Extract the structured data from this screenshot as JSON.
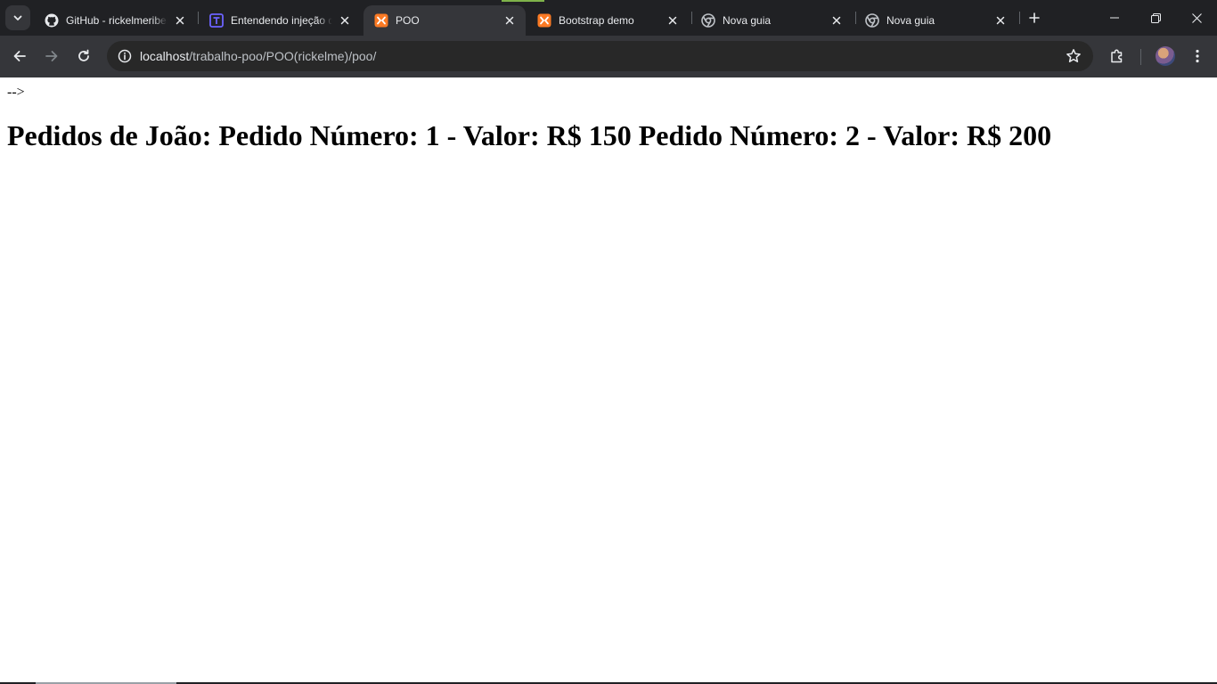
{
  "browser": {
    "tabs": [
      {
        "title": "GitHub - rickelmeribeiro",
        "favicon": "github-icon",
        "active": false
      },
      {
        "title": "Entendendo injeção de dependência",
        "favicon": "devmedia-icon",
        "active": false
      },
      {
        "title": "POO",
        "favicon": "xampp-icon",
        "active": true
      },
      {
        "title": "Bootstrap demo",
        "favicon": "xampp-icon",
        "active": false
      },
      {
        "title": "Nova guia",
        "favicon": "chrome-icon",
        "active": false
      },
      {
        "title": "Nova guia",
        "favicon": "chrome-icon",
        "active": false
      }
    ],
    "address": {
      "host": "localhost",
      "path": "/trabalho-poo/POO(rickelme)/poo/"
    }
  },
  "page": {
    "comment_residue": "-->",
    "heading": "Pedidos de João: Pedido Número: 1 - Valor: R$ 150 Pedido Número: 2 - Valor: R$ 200"
  },
  "colors": {
    "tabstrip_bg": "#202124",
    "toolbar_bg": "#35363a",
    "omnibox_bg": "#282828",
    "xampp_orange": "#fb7a24",
    "devmedia_blue": "#4f46e5"
  }
}
